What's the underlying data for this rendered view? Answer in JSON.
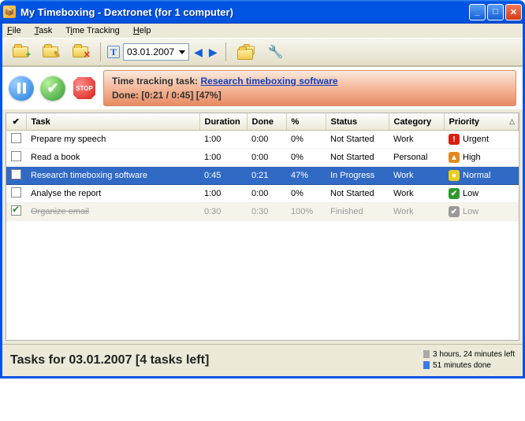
{
  "window": {
    "title": "My Timeboxing - Dextronet (for 1 computer)"
  },
  "menu": {
    "file": "File",
    "task": "Task",
    "time_tracking": "Time Tracking",
    "help": "Help"
  },
  "toolbar": {
    "date": "03.01.2007"
  },
  "tracking": {
    "label": "Time tracking task:",
    "link": "Research timeboxing software",
    "done_label": "Done:",
    "done_value": "[0:21 / 0:45] [47%]"
  },
  "columns": {
    "check": "✔",
    "task": "Task",
    "duration": "Duration",
    "done": "Done",
    "percent": "%",
    "status": "Status",
    "category": "Category",
    "priority": "Priority"
  },
  "tasks": [
    {
      "checked": false,
      "name": "Prepare my speech",
      "duration": "1:00",
      "done": "0:00",
      "percent": "0%",
      "status": "Not Started",
      "category": "Work",
      "priority": "Urgent",
      "pclass": "pUrgent",
      "picon": "!",
      "selected": false,
      "finished": false
    },
    {
      "checked": false,
      "name": "Read a book",
      "duration": "1:00",
      "done": "0:00",
      "percent": "0%",
      "status": "Not Started",
      "category": "Personal",
      "priority": "High",
      "pclass": "pHigh",
      "picon": "▲",
      "selected": false,
      "finished": false
    },
    {
      "checked": false,
      "name": "Research timeboxing software",
      "duration": "0:45",
      "done": "0:21",
      "percent": "47%",
      "status": "In Progress",
      "category": "Work",
      "priority": "Normal",
      "pclass": "pNormal",
      "picon": "●",
      "selected": true,
      "finished": false
    },
    {
      "checked": false,
      "name": "Analyse the report",
      "duration": "1:00",
      "done": "0:00",
      "percent": "0%",
      "status": "Not Started",
      "category": "Work",
      "priority": "Low",
      "pclass": "pLow",
      "picon": "✔",
      "selected": false,
      "finished": false
    },
    {
      "checked": true,
      "name": "Organize email",
      "duration": "0:30",
      "done": "0:30",
      "percent": "100%",
      "status": "Finished",
      "category": "Work",
      "priority": "Low",
      "pclass": "pDone",
      "picon": "✔",
      "selected": false,
      "finished": true
    }
  ],
  "status": {
    "summary": "Tasks for 03.01.2007 [4 tasks left]",
    "line1": "3 hours, 24 minutes left",
    "line2": "51 minutes done"
  }
}
